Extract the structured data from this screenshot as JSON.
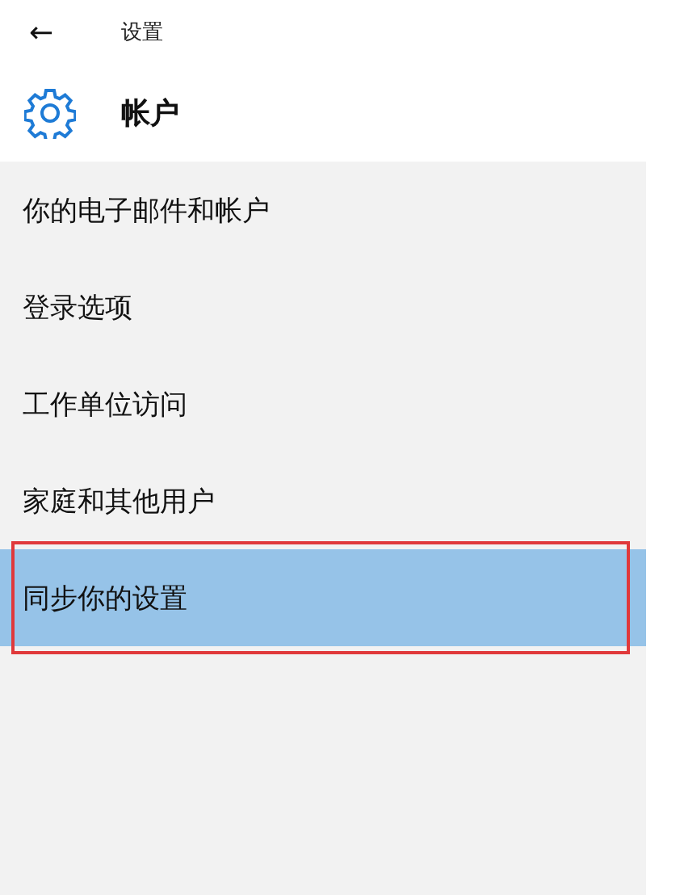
{
  "header": {
    "back": "←",
    "title": "设置"
  },
  "page": {
    "title": "帐户"
  },
  "menu": [
    {
      "label": "你的电子邮件和帐户",
      "selected": false,
      "marked": false
    },
    {
      "label": "登录选项",
      "selected": false,
      "marked": false
    },
    {
      "label": "工作单位访问",
      "selected": false,
      "marked": false
    },
    {
      "label": "家庭和其他用户",
      "selected": false,
      "marked": false
    },
    {
      "label": "同步你的设置",
      "selected": true,
      "marked": true
    }
  ]
}
